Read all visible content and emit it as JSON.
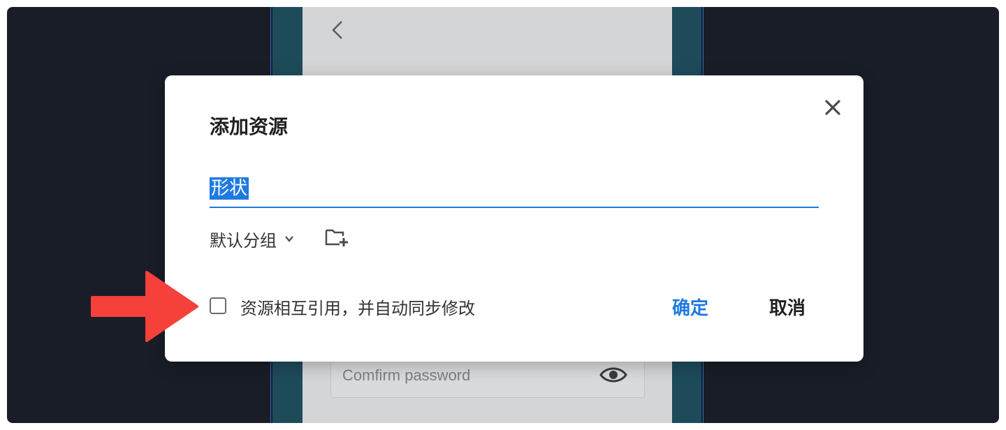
{
  "background_app": {
    "password_placeholder": "Comfirm password"
  },
  "dialog": {
    "title": "添加资源",
    "name_value": "形状",
    "group_label": "默认分组",
    "sync_checkbox_label": "资源相互引用，并自动同步修改",
    "sync_checked": false,
    "confirm_label": "确定",
    "cancel_label": "取消"
  },
  "icons": {
    "close": "close-icon",
    "chevron": "chevron-down-icon",
    "new_folder": "new-folder-icon",
    "back": "back-chevron-icon",
    "eye": "eye-icon",
    "arrow": "red-arrow-icon"
  },
  "colors": {
    "accent": "#1f7ae0",
    "arrow": "#f6403a",
    "backdrop": "#191d27"
  }
}
